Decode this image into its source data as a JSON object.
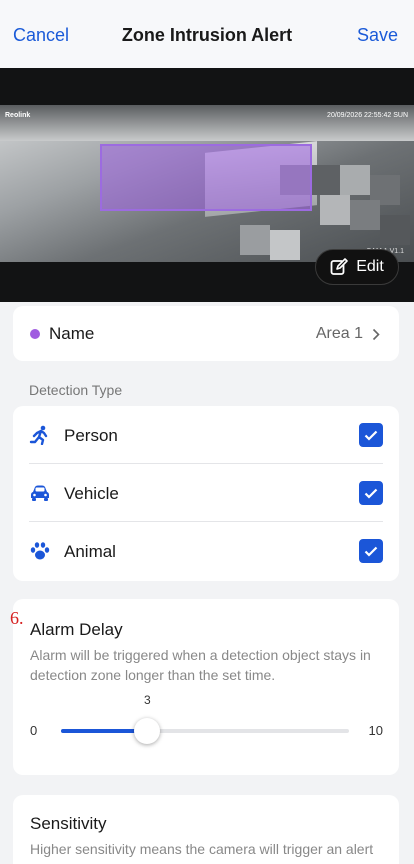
{
  "nav": {
    "cancel": "Cancel",
    "title": "Zone Intrusion Alert",
    "save": "Save"
  },
  "video": {
    "logo": "Reolink",
    "timestamp": "20/09/2026 22:55:42 SUN",
    "channel": "CAM 1 V1.1",
    "edit_label": "Edit"
  },
  "name_row": {
    "label": "Name",
    "value": "Area 1",
    "dot_color": "#a05ce0"
  },
  "detection": {
    "section_label": "Detection Type",
    "items": [
      {
        "label": "Person",
        "icon": "running-person-icon",
        "checked": true
      },
      {
        "label": "Vehicle",
        "icon": "car-icon",
        "checked": true
      },
      {
        "label": "Animal",
        "icon": "paw-icon",
        "checked": true
      }
    ]
  },
  "alarm_delay": {
    "annotation": "6.",
    "title": "Alarm Delay",
    "description": "Alarm will be triggered when a detection object stays in detection zone longer than the set time.",
    "min": "0",
    "max": "10",
    "value": "3",
    "value_num": 3,
    "max_num": 10
  },
  "sensitivity": {
    "title": "Sensitivity",
    "description": "Higher sensitivity means the camera will trigger an alert more easily if something enters the monitored"
  },
  "colors": {
    "accent": "#1b56d8",
    "zone": "#9c6be0"
  }
}
